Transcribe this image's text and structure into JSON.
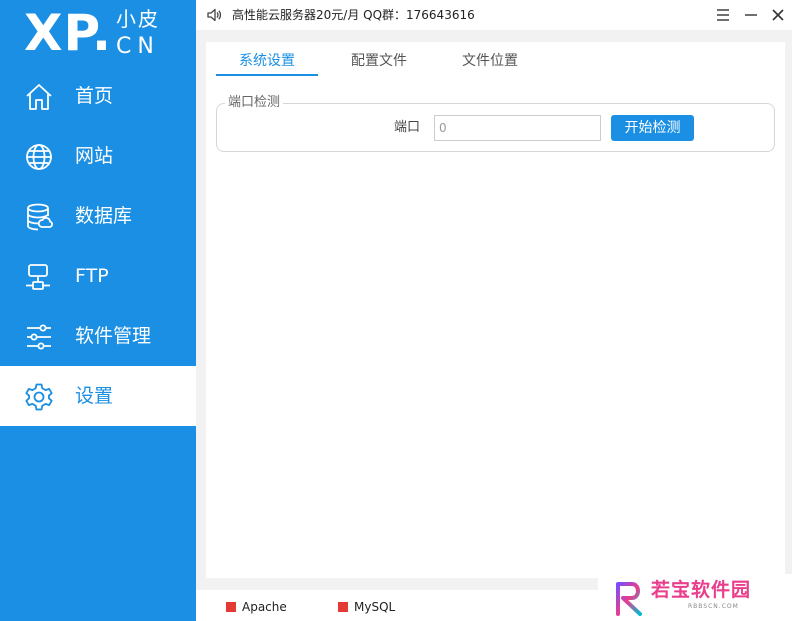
{
  "logo": {
    "main": "XP.",
    "cn_top": "小皮",
    "cn_bottom": "CN"
  },
  "sidebar": {
    "items": [
      {
        "label": "首页",
        "icon": "home-icon"
      },
      {
        "label": "网站",
        "icon": "globe-icon"
      },
      {
        "label": "数据库",
        "icon": "database-icon"
      },
      {
        "label": "FTP",
        "icon": "ftp-icon"
      },
      {
        "label": "软件管理",
        "icon": "sliders-icon"
      },
      {
        "label": "设置",
        "icon": "gear-icon",
        "active": true
      }
    ]
  },
  "topbar": {
    "notice": "高性能云服务器20元/月   QQ群：176643616",
    "icons": [
      "speaker-icon",
      "menu-icon",
      "minimize-icon",
      "close-icon"
    ]
  },
  "tabs": [
    {
      "label": "系统设置",
      "active": true
    },
    {
      "label": "配置文件"
    },
    {
      "label": "文件位置"
    }
  ],
  "port_check": {
    "group_title": "端口检测",
    "port_label": "端口",
    "port_value": "0",
    "button_label": "开始检测"
  },
  "status": {
    "services": [
      {
        "name": "Apache",
        "color": "#e53935"
      },
      {
        "name": "MySQL",
        "color": "#e53935"
      }
    ]
  },
  "watermark": {
    "text": "若宝软件园",
    "sub": "RBBSCN.COM"
  },
  "colors": {
    "accent": "#1a8fe3",
    "stopped": "#e53935",
    "watermark": "#e83e8c"
  }
}
